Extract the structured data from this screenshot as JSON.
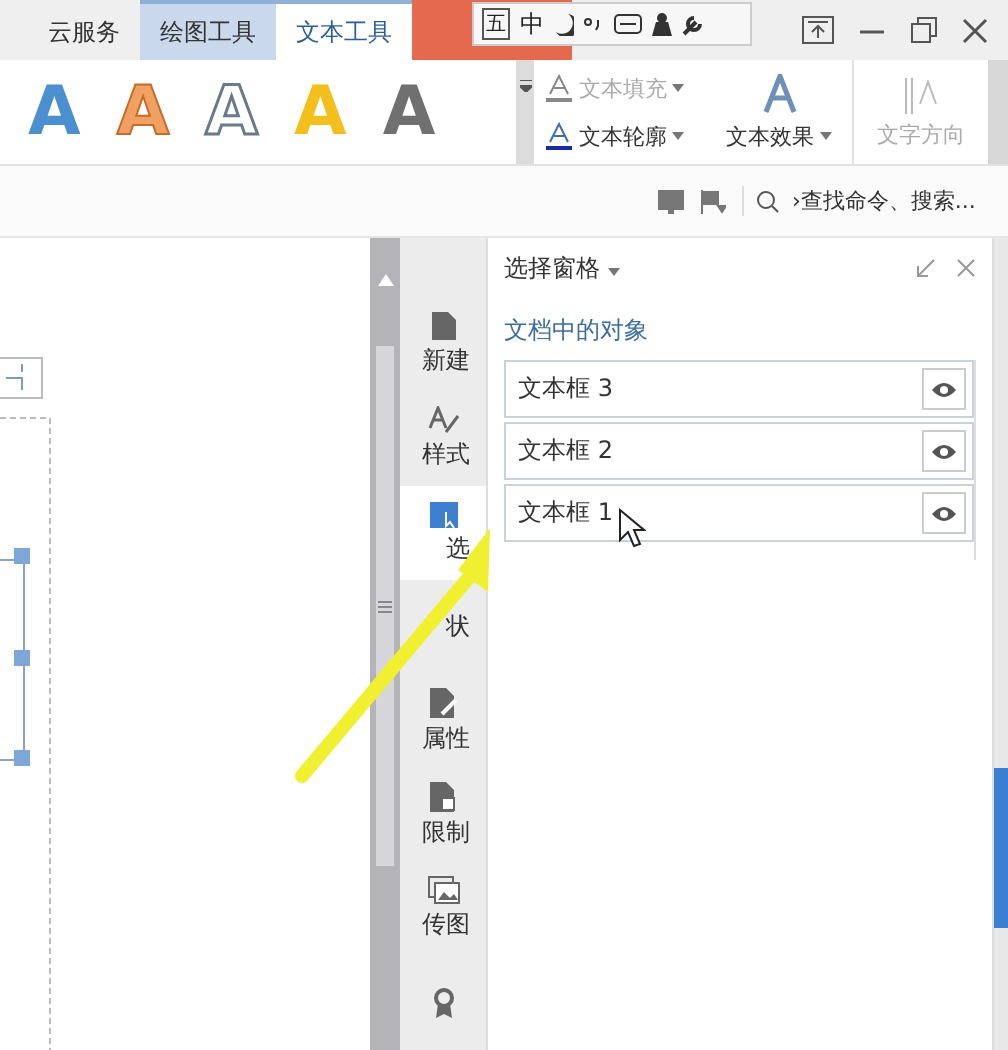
{
  "title_bar": {
    "tabs": [
      {
        "label": "云服务",
        "selected": false
      },
      {
        "label": "绘图工具",
        "selected": false
      },
      {
        "label": "文本工具",
        "selected": true
      }
    ],
    "ime_toolbar": {
      "items": [
        "五",
        "中"
      ]
    }
  },
  "ribbon": {
    "wordart_styles": [
      {
        "label": "A",
        "kind": "filled",
        "color": "#4a8fcf"
      },
      {
        "label": "A",
        "kind": "glow",
        "color": "#f0a060"
      },
      {
        "label": "A",
        "kind": "outline",
        "color": "#ffffff"
      },
      {
        "label": "A",
        "kind": "filled",
        "color": "#f2bf1c"
      },
      {
        "label": "A",
        "kind": "gradient",
        "color": "#707070"
      }
    ],
    "commands": [
      {
        "kind": "fill",
        "label": "文本填充",
        "disabled": true
      },
      {
        "kind": "outline",
        "label": "文本轮廓",
        "disabled": false
      },
      {
        "kind": "effect",
        "label": "文本效果",
        "disabled": false
      },
      {
        "kind": "direction",
        "label": "文字方向",
        "disabled": true
      }
    ]
  },
  "command_bar": {
    "search": {
      "placeholder": "›查找命令、搜索..."
    }
  },
  "side_tabs": [
    {
      "label": "新建",
      "kind": "new",
      "selected": false
    },
    {
      "label": "样式",
      "kind": "style",
      "selected": false
    },
    {
      "label": "选",
      "kind": "select",
      "selected": true
    },
    {
      "label": "状",
      "kind": "shape",
      "selected": false
    },
    {
      "label": "属性",
      "kind": "property",
      "selected": false
    },
    {
      "label": "限制",
      "kind": "restrict",
      "selected": false
    },
    {
      "label": "传图",
      "kind": "picture",
      "selected": false
    },
    {
      "kind": "award",
      "selected": false
    }
  ],
  "selection_pane": {
    "title": "选择窗格",
    "section": "文档中的对象",
    "objects": [
      {
        "name": "文本框 3",
        "visible": true
      },
      {
        "name": "文本框 2",
        "visible": true
      },
      {
        "name": "文本框 1",
        "visible": true
      }
    ]
  }
}
